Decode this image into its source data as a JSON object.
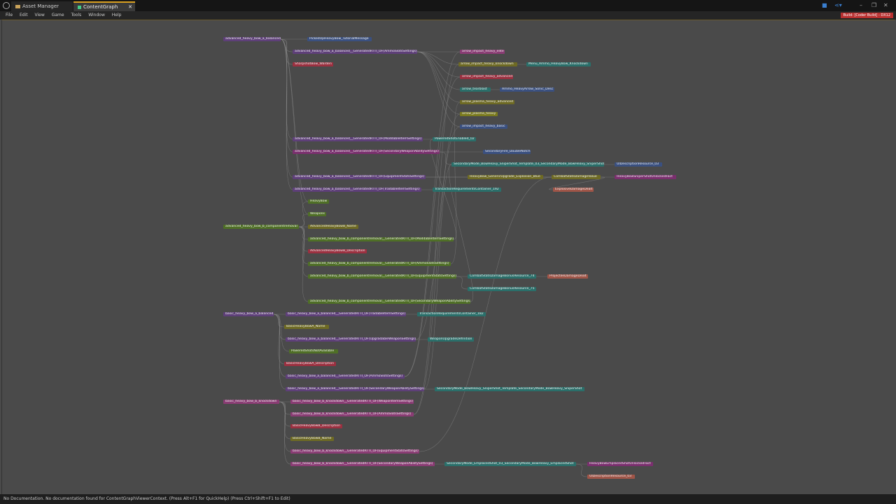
{
  "window": {
    "tabs": [
      {
        "label": "Asset Manager"
      },
      {
        "label": "ContentGraph"
      }
    ],
    "build_badge": "Build: [Coder Build] - DX12"
  },
  "menu": [
    "File",
    "Edit",
    "View",
    "Game",
    "Tools",
    "Window",
    "Help"
  ],
  "status": "No Documentation. No documentation found for ContentGraphViewerContext. (Press Alt+F1 for QuickHelp) (Press Ctrl+Shift+F1 to Edit)",
  "nodes": [
    {
      "label": "advanced_heavy_bow_a_balanced",
      "color": "purple"
    },
    {
      "label": "PickedUpHeavyBow_TutorialMessage",
      "color": "blue"
    },
    {
      "label": "advanced_heavy_bow_a_balanced__GeneratedRTTI_OF(AmmoSlotsSettings)",
      "color": "purple"
    },
    {
      "label": "SharpshotBow_Warden",
      "color": "red"
    },
    {
      "label": "arrow_impact_heavy_elite",
      "color": "pink"
    },
    {
      "label": "arrow_impact_heavy_knockdown",
      "color": "olive"
    },
    {
      "label": "Menu_Ammo_HeavyBow_Knockdown",
      "color": "teal"
    },
    {
      "label": "arrow_impact_heavy_advanced",
      "color": "red"
    },
    {
      "label": "arrow_tearblast",
      "color": "teal"
    },
    {
      "label": "Ammo_HeavyArrow_Sonic_Desc",
      "color": "blue"
    },
    {
      "label": "arrow_plasma_heavy_advanced",
      "color": "olive"
    },
    {
      "label": "arrow_plasma_heavy",
      "color": "yellow"
    },
    {
      "label": "arrow_impact_heavy_basic",
      "color": "blue"
    },
    {
      "label": "advanced_heavy_bow_a_balanced__GeneratedRTTI_OF(ModdableItemSettings)",
      "color": "purple"
    },
    {
      "label": "PoweredShotEnabled_02",
      "color": "teal"
    },
    {
      "label": "advanced_heavy_bow_a_balanced__GeneratedRTTI_OF(SecondaryWeaponAbilitySettings)",
      "color": "mag"
    },
    {
      "label": "SecondaryFire_DoubleNotch",
      "color": "blue"
    },
    {
      "label": "SecondaryMode_BowHeavy_SniperShot_Template_03_SecondaryMode_BowHeavy_SniperShot",
      "color": "teal"
    },
    {
      "label": "UIDescriptionResource_03",
      "color": "blue"
    },
    {
      "label": "advanced_heavy_bow_a_balanced__GeneratedRTTI_OF(EquipmentStatsSettings)",
      "color": "purple"
    },
    {
      "label": "HeavyBow_GenericUpgrade_Explosion_Blue",
      "color": "olive"
    },
    {
      "label": "CombatStatsDamageValue",
      "color": "olive"
    },
    {
      "label": "HeavyBowSniperShotUnlockedFact",
      "color": "mag"
    },
    {
      "label": "advanced_heavy_bow_a_balanced__GeneratedRTTI_OF(TradableItemSettings)",
      "color": "purple"
    },
    {
      "label": "TransactionRequirementsContainer_192",
      "color": "teal"
    },
    {
      "label": "ExplosiveDamageDealt",
      "color": "salmon"
    },
    {
      "label": "HeavyBow",
      "color": "green"
    },
    {
      "label": "Weapons",
      "color": "green"
    },
    {
      "label": "advanced_heavy_bow_b_componentremoval",
      "color": "green"
    },
    {
      "label": "AdvancedHeavyBowB_Name",
      "color": "olive"
    },
    {
      "label": "advanced_heavy_bow_b_componentremoval__GeneratedRTTI_OF(ModdableItemSettings)",
      "color": "green"
    },
    {
      "label": "AdvancedHeavyBowB_Description",
      "color": "red"
    },
    {
      "label": "advanced_heavy_bow_b_componentremoval__GeneratedRTTI_OF(AmmoSlotsSettings)",
      "color": "green"
    },
    {
      "label": "advanced_heavy_bow_b_componentremoval__GeneratedRTTI_OF(EquipmentStatsSettings)",
      "color": "green"
    },
    {
      "label": "CombatStatsDamageBonusResource_74",
      "color": "teal"
    },
    {
      "label": "ProjectileDamageDealt",
      "color": "salmon"
    },
    {
      "label": "CombatStatsDamageBonusResource_75",
      "color": "teal"
    },
    {
      "label": "advanced_heavy_bow_b_componentremoval__GeneratedRTTI_OF(SecondaryWeaponAbilitySettings)",
      "color": "green"
    },
    {
      "label": "basic_heavy_bow_a_balanced",
      "color": "purple"
    },
    {
      "label": "basic_heavy_bow_a_balanced__GeneratedRTTI_OF(TradableItemSettings)",
      "color": "purple"
    },
    {
      "label": "TransactionRequirementsContainer_182",
      "color": "teal"
    },
    {
      "label": "BasicHeavyBowA_Name",
      "color": "olive"
    },
    {
      "label": "basic_heavy_bow_a_balanced__GeneratedRTTI_OF(UpgradableWeaponSettings)",
      "color": "purple"
    },
    {
      "label": "WeaponUpgradeDefinition",
      "color": "teal"
    },
    {
      "label": "PoweredShotsNotAvailable",
      "color": "green"
    },
    {
      "label": "BasicHeavyBowA_Description",
      "color": "red"
    },
    {
      "label": "basic_heavy_bow_a_balanced__GeneratedRTTI_OF(AmmoSlotsSettings)",
      "color": "purple"
    },
    {
      "label": "basic_heavy_bow_a_balanced__GeneratedRTTI_OF(SecondaryWeaponAbilitySettings)",
      "color": "purple"
    },
    {
      "label": "SecondaryMode_BowHeavy_SniperShot_Template_SecondaryMode_BowHeavy_SniperShot",
      "color": "teal"
    },
    {
      "label": "basic_heavy_bow_b_knockdown",
      "color": "pink"
    },
    {
      "label": "basic_heavy_bow_b_knockdown__GeneratedRTTI_OF(WeaponItemSettings)",
      "color": "pink"
    },
    {
      "label": "basic_heavy_bow_b_knockdown__GeneratedRTTI_OF(AmmoSlotsSettings)",
      "color": "pink"
    },
    {
      "label": "BasicHeavyBowB_Description",
      "color": "red"
    },
    {
      "label": "BasicHeavyBowB_Name",
      "color": "olive"
    },
    {
      "label": "basic_heavy_bow_b_knockdown__GeneratedRTTI_OF(EquipmentStatsSettings)",
      "color": "pink"
    },
    {
      "label": "basic_heavy_bow_b_knockdown__GeneratedRTTI_OF(SecondaryWeaponAbilitySettings)",
      "color": "pink"
    },
    {
      "label": "SecondaryMode_EmplacedShot_03_SecondaryMode_BowHeavy_EmplacedShot",
      "color": "teal"
    },
    {
      "label": "HeavyBowEmplacedShotUnlockedFact",
      "color": "mag"
    },
    {
      "label": "UIDescriptionResource_03",
      "color": "salmon"
    }
  ]
}
